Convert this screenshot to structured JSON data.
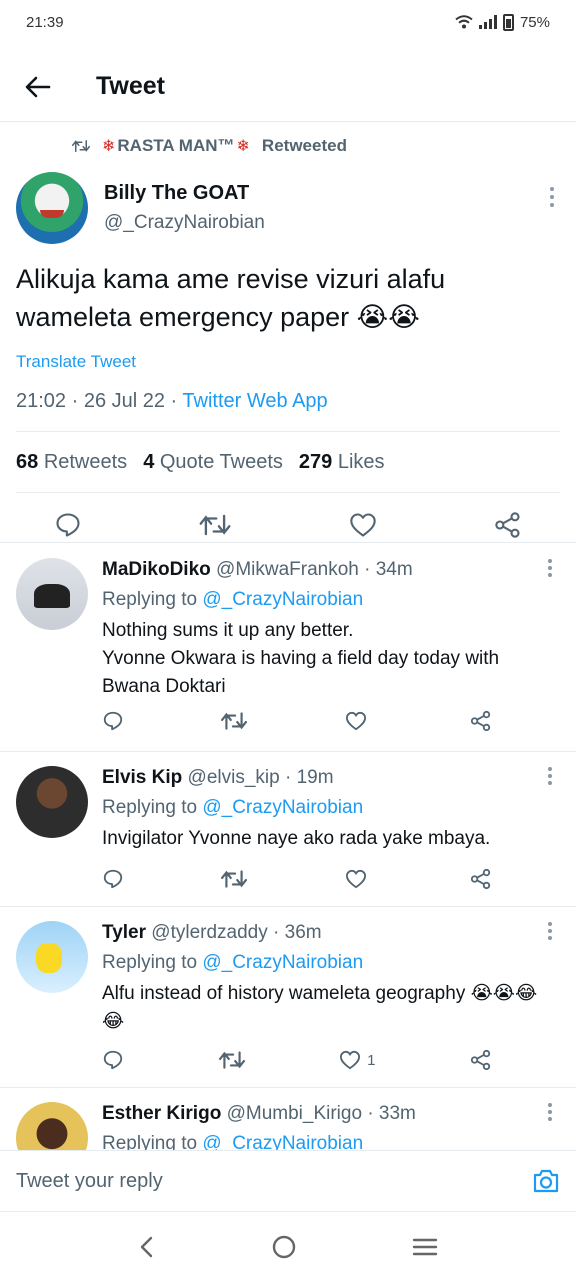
{
  "status_bar": {
    "time": "21:39",
    "battery": "75%"
  },
  "header": {
    "title": "Tweet"
  },
  "retweeted_by": {
    "name": "RASTA MAN™",
    "suffix": "Retweeted"
  },
  "main_tweet": {
    "author_name": "Billy The GOAT",
    "author_handle": "@_CrazyNairobian",
    "text": "Alikuja kama ame revise vizuri alafu wameleta emergency paper 😭😭",
    "translate": "Translate Tweet",
    "time": "21:02 · 26 Jul 22 · ",
    "source": "Twitter Web App",
    "stats": {
      "retweets_count": "68",
      "retweets_label": "Retweets",
      "quotes_count": "4",
      "quotes_label": "Quote Tweets",
      "likes_count": "279",
      "likes_label": "Likes"
    }
  },
  "replies": [
    {
      "name": "MaDikoDiko",
      "meta": "@MikwaFrankoh · 34m",
      "replying_prefix": "Replying to ",
      "replying_handle": "@_CrazyNairobian",
      "text_line1": "Nothing sums it up any better.",
      "text_line2": "Yvonne Okwara is having a field day today with Bwana Doktari",
      "likes": ""
    },
    {
      "name": "Elvis Kip",
      "meta": "@elvis_kip · 19m",
      "replying_prefix": "Replying to ",
      "replying_handle": "@_CrazyNairobian",
      "text_line1": "Invigilator Yvonne naye ako rada yake mbaya.",
      "likes": ""
    },
    {
      "name": "Tyler",
      "meta": "@tylerdzaddy · 36m",
      "replying_prefix": "Replying to ",
      "replying_handle": "@_CrazyNairobian",
      "text_line1": "Alfu instead of history wameleta geography 😭😭😂😂",
      "likes": "1"
    },
    {
      "name": "Esther Kirigo",
      "meta": "@Mumbi_Kirigo · 33m",
      "replying_prefix": "Replying to ",
      "replying_handle": "@_CrazyNairobian"
    }
  ],
  "reply_input": {
    "placeholder": "Tweet your reply"
  },
  "colors": {
    "accent": "#1d9bf0",
    "text": "#0f1419",
    "muted": "#536471",
    "divider": "#e6ecf0",
    "maple": "#d42a1e"
  }
}
